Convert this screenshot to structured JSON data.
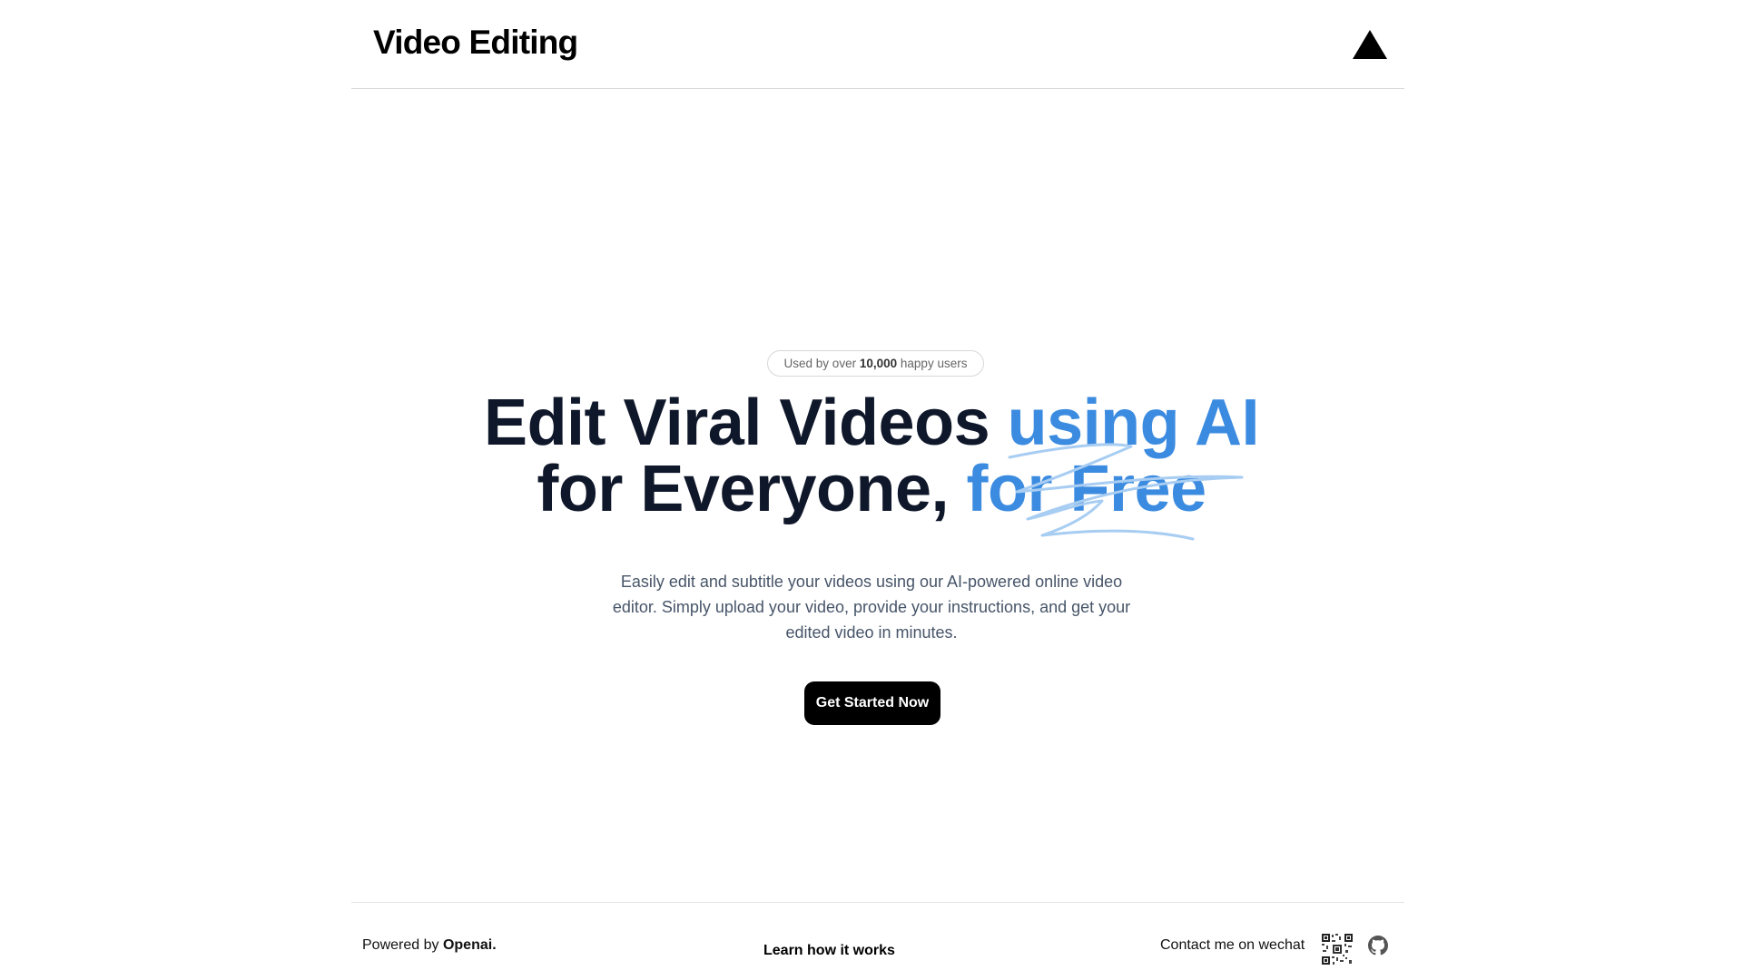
{
  "header": {
    "brand": "Video Editing",
    "logo_icon": "triangle-logo-icon"
  },
  "hero": {
    "badge": {
      "prefix": "Used by over",
      "count": "10,000",
      "suffix": "happy users"
    },
    "headline": {
      "line1_main": "Edit Viral Videos",
      "line1_accent": "using AI",
      "line2_main": "for Everyone,",
      "line2_accent": "for Free"
    },
    "subtitle": "Easily edit and subtitle your videos using our AI-powered online video editor. Simply upload your video, provide your instructions, and get your edited video in minutes.",
    "cta_label": "Get Started Now"
  },
  "footer": {
    "powered_prefix": "Powered by",
    "powered_brand": "Openai.",
    "learn_link": "Learn how it works",
    "contact_label": "Contact me on wechat",
    "qr_icon": "qr-code-icon",
    "github_icon": "github-icon"
  },
  "colors": {
    "accent": "#3b8be0",
    "headline": "#0f172a",
    "button_bg": "#000000"
  }
}
